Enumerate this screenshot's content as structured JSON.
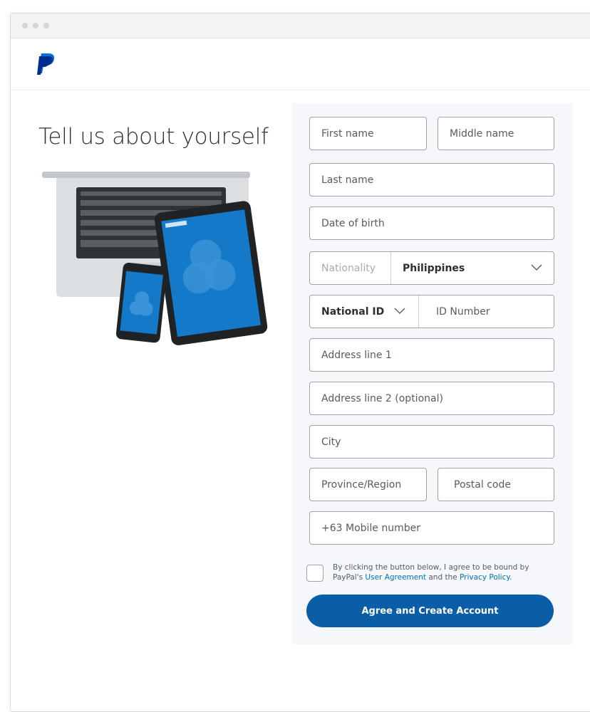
{
  "brand": {
    "logo_icon": "paypal-logo-icon",
    "primary_color": "#0a5ea8",
    "link_color": "#0070ba"
  },
  "page": {
    "heading": "Tell us about yourself"
  },
  "form": {
    "first_name_placeholder": "First name",
    "middle_name_placeholder": "Middle name",
    "last_name_placeholder": "Last name",
    "dob_placeholder": "Date of birth",
    "nationality_label": "Nationality",
    "nationality_value": "Philippines",
    "id_type_value": "National ID",
    "id_number_placeholder": "ID Number",
    "address1_placeholder": "Address line 1",
    "address2_placeholder": "Address line 2 (optional)",
    "city_placeholder": "City",
    "province_placeholder": "Province/Region",
    "postal_placeholder": "Postal code",
    "mobile_placeholder": "+63 Mobile number",
    "agreement": {
      "text_before": "By clicking the button below, I agree to be bound by PayPal's ",
      "user_agreement_link": "User Agreement",
      "text_middle": " and the ",
      "privacy_link": "Privacy Policy",
      "text_after": ".",
      "checked": false
    },
    "submit_label": "Agree and Create Account"
  }
}
